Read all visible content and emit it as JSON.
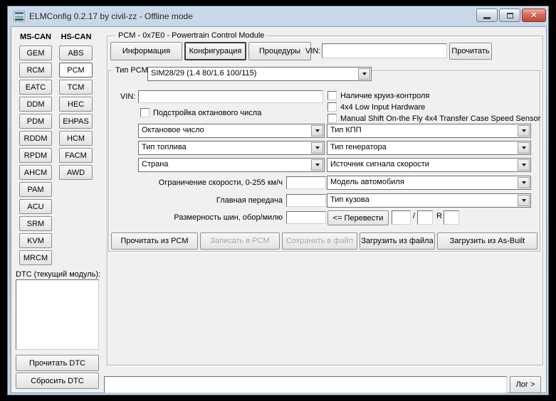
{
  "window": {
    "title": "ELMConfig 0.2.17 by civil-zz - Offline mode"
  },
  "sidebar": {
    "ms_can_header": "MS-CAN",
    "hs_can_header": "HS-CAN",
    "ms_can_buttons": [
      "GEM",
      "RCM",
      "EATC",
      "DDM",
      "PDM",
      "RDDM",
      "RPDM",
      "AHCM",
      "PAM",
      "ACU",
      "SRM",
      "KVM",
      "MRCM"
    ],
    "hs_can_buttons": [
      "ABS",
      "PCM",
      "TCM",
      "HEC",
      "EHPAS",
      "HCM",
      "FACM",
      "AWD"
    ],
    "active_module": "PCM",
    "dtc_label": "DTC (текущий модуль):",
    "read_dtc_button": "Прочитать DTC",
    "clear_dtc_button": "Сбросить DTC"
  },
  "main": {
    "group_title": "PCM - 0x7E0 - Powertrain Control Module",
    "tab_info": "Информация",
    "tab_config": "Конфигурация",
    "tab_procedures": "Процедуры",
    "active_tab": "Конфигурация",
    "vin_label": "VIN:",
    "vin_value": "",
    "read_vin_button": "Прочитать",
    "pcm_type_label": "Тип PCM:",
    "pcm_type_value": "SIM28/29 (1.4 80/1.6 100/115)",
    "config": {
      "vin_label": "VIN:",
      "vin_value": "",
      "octane_adjust_checkbox": "Подстройка октанового числа",
      "cruise_checkbox": "Наличие круиз-контроля",
      "low4x4_checkbox": "4x4 Low Input Hardware",
      "manual_shift_checkbox": "Manual Shift On-the Fly 4x4 Transfer Case Speed Sensor",
      "octane_dropdown": "Октановое число",
      "fuel_dropdown": "Тип топлива",
      "country_dropdown": "Страна",
      "gearbox_dropdown": "Тип КПП",
      "generator_dropdown": "Тип генератора",
      "speed_source_dropdown": "Источник сигнала скорости",
      "model_dropdown": "Модель автомобиля",
      "body_dropdown": "Тип кузова",
      "speed_limit_label": "Ограничение скорости, 0-255 км/ч",
      "speed_limit_value": "",
      "final_drive_label": "Главная передача",
      "final_drive_value": "",
      "tire_size_label": "Размерность шин, обор/милю",
      "tire_size_value": "",
      "convert_button": "<= Перевести",
      "tire_width_value": "",
      "tire_slash": "/",
      "tire_profile_value": "",
      "tire_r": "R",
      "tire_diameter_value": ""
    },
    "actions": {
      "read_pcm": {
        "label": "Прочитать из PCM",
        "enabled": true
      },
      "write_pcm": {
        "label": "Записать в PCM",
        "enabled": false
      },
      "save_file": {
        "label": "Сохранить в файл",
        "enabled": false
      },
      "load_file": {
        "label": "Загрузить из файла",
        "enabled": true
      },
      "load_asbuilt": {
        "label": "Загрузить из As-Built",
        "enabled": true
      }
    }
  },
  "footer": {
    "log_value": "",
    "log_button": "Лог >"
  }
}
